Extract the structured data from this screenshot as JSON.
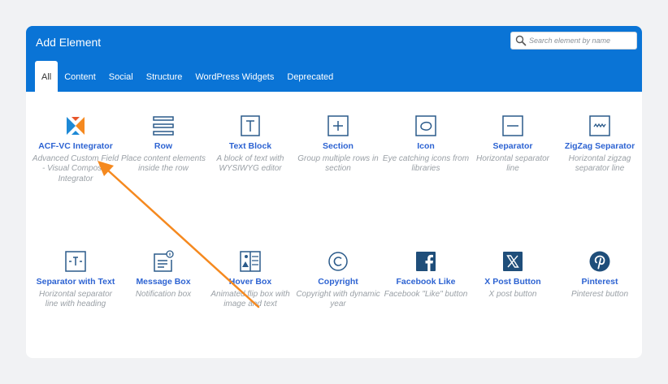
{
  "dialog": {
    "title": "Add Element",
    "search_placeholder": "Search element by name"
  },
  "tabs": [
    {
      "label": "All",
      "active": true
    },
    {
      "label": "Content"
    },
    {
      "label": "Social"
    },
    {
      "label": "Structure"
    },
    {
      "label": "WordPress Widgets"
    },
    {
      "label": "Deprecated"
    }
  ],
  "elements": [
    {
      "name": "ACF-VC Integrator",
      "desc": "Advanced Custom Field - Visual Composer Integrator",
      "icon": "acf-vc-logo-icon"
    },
    {
      "name": "Row",
      "desc": "Place content elements inside the row",
      "icon": "row-icon"
    },
    {
      "name": "Text Block",
      "desc": "A block of text with WYSIWYG editor",
      "icon": "text-block-icon"
    },
    {
      "name": "Section",
      "desc": "Group multiple rows in section",
      "icon": "section-icon"
    },
    {
      "name": "Icon",
      "desc": "Eye catching icons from libraries",
      "icon": "icon-element-icon"
    },
    {
      "name": "Separator",
      "desc": "Horizontal separator line",
      "icon": "separator-icon"
    },
    {
      "name": "ZigZag Separator",
      "desc": "Horizontal zigzag separator line",
      "icon": "zigzag-separator-icon"
    },
    {
      "name": "Separator with Text",
      "desc": "Horizontal separator line with heading",
      "icon": "separator-with-text-icon"
    },
    {
      "name": "Message Box",
      "desc": "Notification box",
      "icon": "message-box-icon"
    },
    {
      "name": "Hover Box",
      "desc": "Animated flip box with image and text",
      "icon": "hover-box-icon"
    },
    {
      "name": "Copyright",
      "desc": "Copyright with dynamic year",
      "icon": "copyright-icon"
    },
    {
      "name": "Facebook Like",
      "desc": "Facebook \"Like\" button",
      "icon": "facebook-icon"
    },
    {
      "name": "X Post Button",
      "desc": "X post button",
      "icon": "x-icon"
    },
    {
      "name": "Pinterest",
      "desc": "Pinterest button",
      "icon": "pinterest-icon"
    }
  ],
  "colors": {
    "header": "#0a74d6",
    "element_name": "#2d63d2",
    "description": "#9aa0a6",
    "annotation_arrow": "#f5891f"
  }
}
